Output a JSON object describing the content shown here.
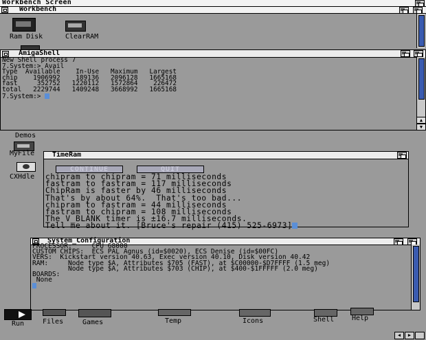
{
  "screen": {
    "title": "Workbench Screen"
  },
  "workbench": {
    "title": "Workbench"
  },
  "desktop_icons": [
    {
      "label": "Ram Disk",
      "icon": "ram-disk-icon"
    },
    {
      "label": "ClearRAM",
      "icon": "clearram-icon"
    },
    {
      "label": "Demos",
      "icon": "drawer-icon"
    },
    {
      "label": "MyFile",
      "icon": "drawer-icon"
    },
    {
      "label": "CXHdle",
      "icon": "commodity-icon"
    }
  ],
  "shell": {
    "title": "AmigaShell",
    "lines": [
      "New Shell process 7",
      "7.System:> Avail",
      "Type  Available    In-Use   Maximum   Largest",
      "chip    1906992    189136   2096128   1665168",
      "fast     352752   1220112   1572864    226472",
      "total   2229744   1409248   3668992   1665168",
      "7.System:> "
    ]
  },
  "timeram": {
    "title": "TimeRam",
    "continue_label": "CONTINUE",
    "quit_label": "QUIT",
    "lines": [
      "chipram to chipram = 71 milliseconds",
      "fastram to fastram = 117 milliseconds",
      "ChipRam is faster by 46 milliseconds",
      "That's by about 64%.  That's too bad...",
      "chipram to fastram = 44 milliseconds",
      "fastram to chipram = 108 milliseconds",
      "The V_BLANK timer is ±16.7 milliseconds.",
      "Tell me about it. [Bruce's repair (415) 525-6973]"
    ]
  },
  "sysconfig": {
    "title": "System_Configuration",
    "lines": [
      "PROCESSOR:     CPU 68000",
      "CUSTOM CHIPS:  ECS PAL Agnus (id=$0020), ECS Denise (id=$00FC)",
      "VERS:  Kickstart version 40.63, Exec version 40.10, Disk version 40.42",
      "RAM:     Node type $A, Attributes $705 (FAST), at $C00000-$D7FFFF (1.5 meg)",
      "         Node type $A, Attributes $703 (CHIP), at $400-$1FFFFF (2.0 meg)",
      "BOARDS:",
      " None"
    ]
  },
  "dock": [
    {
      "label": "Run"
    },
    {
      "label": "Files"
    },
    {
      "label": "Games"
    },
    {
      "label": "Temp"
    },
    {
      "label": "Icons"
    },
    {
      "label": "Shell"
    },
    {
      "label": "Help"
    }
  ]
}
